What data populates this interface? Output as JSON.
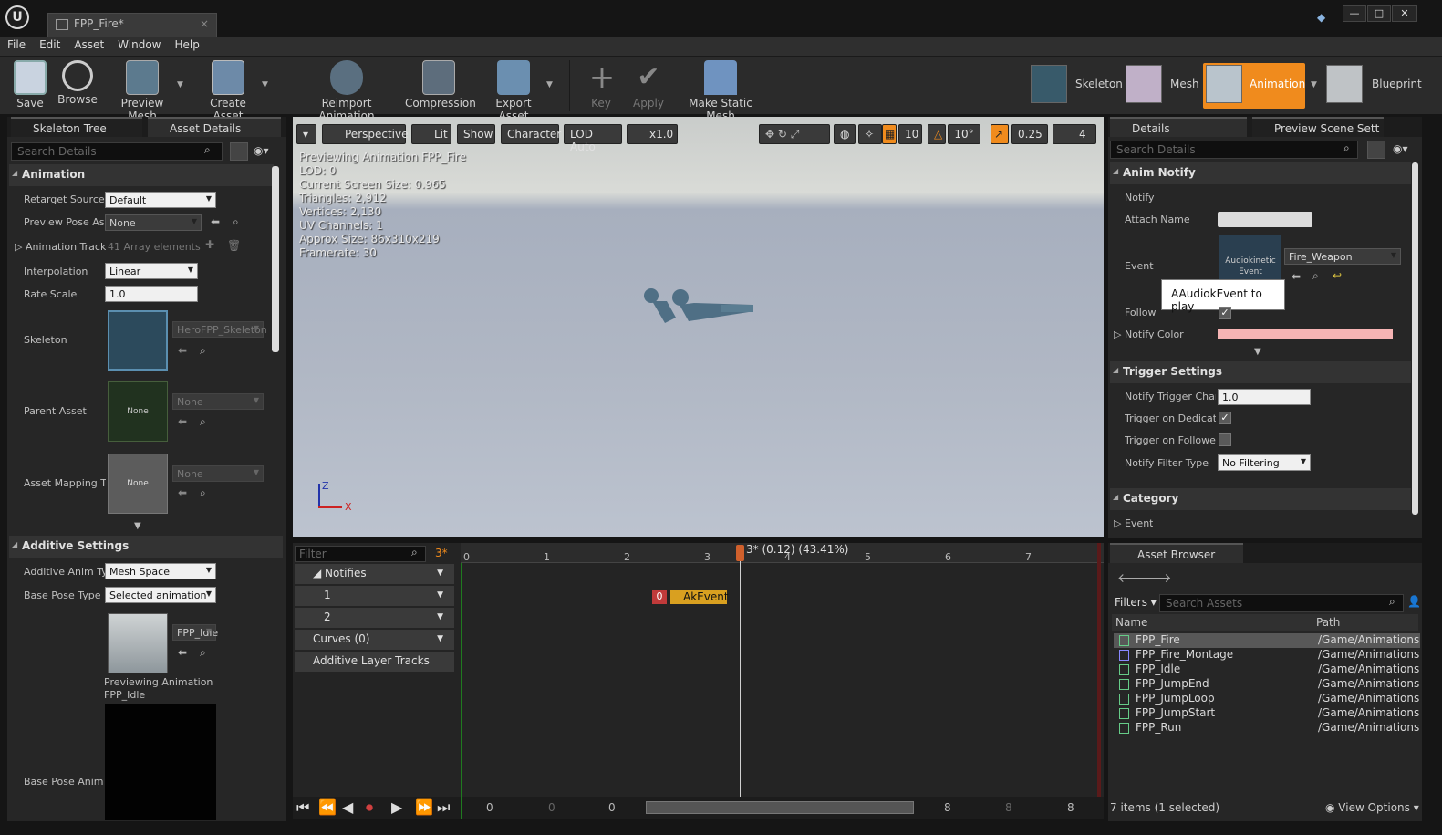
{
  "window": {
    "tab_title": "FPP_Fire*",
    "logo": "U",
    "controls": [
      "—",
      "□",
      "✕"
    ]
  },
  "menu": [
    "File",
    "Edit",
    "Asset",
    "Window",
    "Help"
  ],
  "toolbar": {
    "buttons": [
      {
        "label": "Save",
        "icon": "save-icon"
      },
      {
        "label": "Browse",
        "icon": "browse-icon"
      },
      {
        "label": "Preview Mesh",
        "icon": "preview-mesh-icon"
      },
      {
        "label": "Create Asset",
        "icon": "create-asset-icon"
      },
      {
        "label": "Reimport Animation",
        "icon": "reimport-icon"
      },
      {
        "label": "Compression",
        "icon": "compression-icon"
      },
      {
        "label": "Export Asset",
        "icon": "export-icon"
      },
      {
        "label": "Key",
        "icon": "key-plus-icon"
      },
      {
        "label": "Apply",
        "icon": "apply-check-icon"
      },
      {
        "label": "Make Static Mesh",
        "icon": "static-mesh-icon"
      }
    ],
    "modes": [
      {
        "label": "Skeleton",
        "active": false
      },
      {
        "label": "Mesh",
        "active": false
      },
      {
        "label": "Animation",
        "active": true
      },
      {
        "label": "Blueprint",
        "active": false
      }
    ],
    "active_color": "#f08b1d"
  },
  "left": {
    "tabs": [
      "Skeleton Tree",
      "Asset Details"
    ],
    "search_placeholder": "Search Details",
    "animation_section": "Animation",
    "props": {
      "retarget_source_label": "Retarget Source",
      "retarget_source_value": "Default",
      "preview_pose_label": "Preview Pose As",
      "preview_pose_value": "None",
      "anim_track_label": "Animation Track",
      "anim_track_value": "41 Array elements",
      "interpolation_label": "Interpolation",
      "interpolation_value": "Linear",
      "rate_scale_label": "Rate Scale",
      "rate_scale_value": "1.0",
      "skeleton_label": "Skeleton",
      "skeleton_value": "HeroFPP_Skeleton",
      "parent_asset_label": "Parent Asset",
      "parent_asset_value": "None",
      "parent_asset_thumb": "None",
      "asset_mapping_label": "Asset Mapping T",
      "asset_mapping_value": "None",
      "asset_mapping_thumb": "None"
    },
    "additive_section": "Additive Settings",
    "additive": {
      "anim_type_label": "Additive Anim Ty",
      "anim_type_value": "Mesh Space",
      "base_pose_type_label": "Base Pose Type",
      "base_pose_type_value": "Selected animation",
      "base_pose_anim_value": "FPP_Idle",
      "previewing_line1": "Previewing Animation",
      "previewing_line2": "FPP_Idle",
      "base_pose_anim_label": "Base Pose Anim"
    }
  },
  "viewport": {
    "toolbar": [
      "Perspective",
      "Lit",
      "Show",
      "Character",
      "LOD Auto",
      "x1.0"
    ],
    "grid_snap": "10",
    "rot_snap": "10°",
    "scale_snap": "0.25",
    "cam_speed": "4",
    "info": [
      "Previewing Animation FPP_Fire",
      "LOD: 0",
      "Current Screen Size: 0.965",
      "Triangles: 2,912",
      "Vertices: 2,130",
      "UV Channels: 1",
      "Approx Size: 86x310x219",
      "Framerate: 30"
    ],
    "axis_z": "Z",
    "axis_x": "X"
  },
  "timeline": {
    "filter_placeholder": "Filter",
    "frame_badge": "3*",
    "tracks": [
      "Notifies",
      "1",
      "2",
      "Curves  (0)",
      "Additive Layer Tracks"
    ],
    "ruler": [
      "0",
      "1",
      "2",
      "3",
      "4",
      "5",
      "6",
      "7"
    ],
    "scrub_label": "3* (0.12) (43.41%)",
    "notify_index": "0",
    "notify_name": "AkEvent",
    "range_values": [
      "0",
      "0",
      "0",
      "8",
      "8",
      "8"
    ]
  },
  "details": {
    "tabs": [
      "Details",
      "Preview Scene Sett"
    ],
    "search_placeholder": "Search Details",
    "anim_notify_section": "Anim Notify",
    "notify_label": "Notify",
    "attach_name_label": "Attach Name",
    "event_label": "Event",
    "event_thumb_line1": "Audiokinetic",
    "event_thumb_line2": "Event",
    "event_value": "Fire_Weapon",
    "tooltip": "AAudiokEvent to play",
    "follow_label": "Follow",
    "notify_color_label": "Notify Color",
    "notify_color": "#f6b4b4",
    "trigger_section": "Trigger Settings",
    "trigger_chance_label": "Notify Trigger Chan",
    "trigger_chance_value": "1.0",
    "trigger_dedicated_label": "Trigger on Dedicate",
    "trigger_follower_label": "Trigger on Follower",
    "filter_type_label": "Notify Filter Type",
    "filter_type_value": "No Filtering",
    "category_section": "Category",
    "category_event_label": "Event"
  },
  "asset_browser": {
    "tab": "Asset Browser",
    "filters_label": "Filters",
    "search_placeholder": "Search Assets",
    "col_name": "Name",
    "col_path": "Path",
    "rows": [
      {
        "name": "FPP_Fire",
        "path": "/Game/Animations"
      },
      {
        "name": "FPP_Fire_Montage",
        "path": "/Game/Animations"
      },
      {
        "name": "FPP_Idle",
        "path": "/Game/Animations"
      },
      {
        "name": "FPP_JumpEnd",
        "path": "/Game/Animations"
      },
      {
        "name": "FPP_JumpLoop",
        "path": "/Game/Animations"
      },
      {
        "name": "FPP_JumpStart",
        "path": "/Game/Animations"
      },
      {
        "name": "FPP_Run",
        "path": "/Game/Animations"
      }
    ],
    "status": "7 items (1 selected)",
    "view_options": "View Options"
  }
}
